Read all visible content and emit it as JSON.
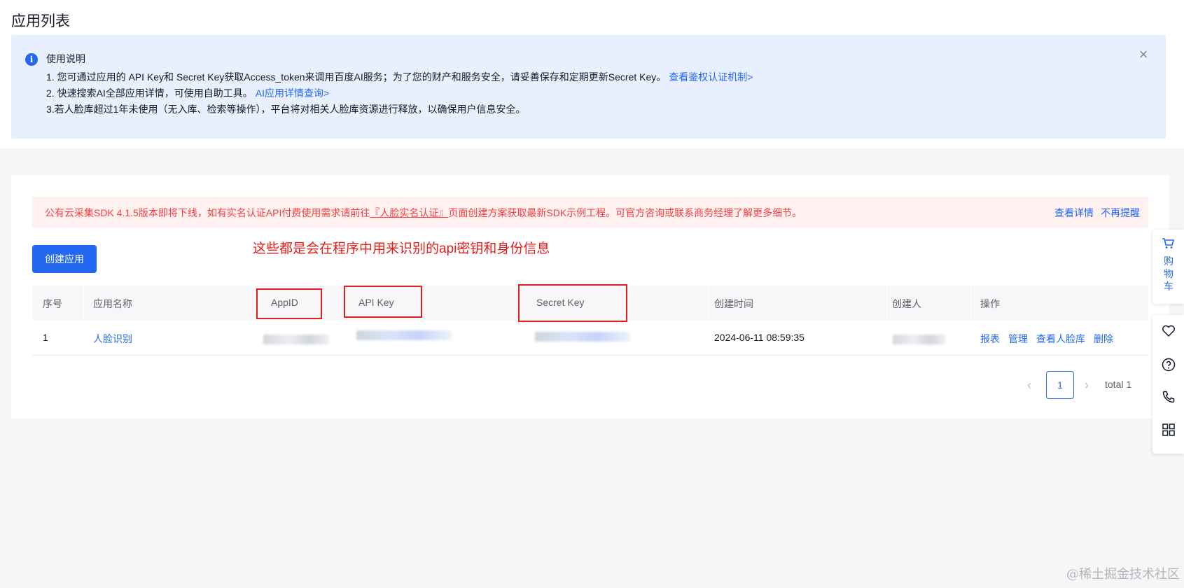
{
  "page_title": "应用列表",
  "notice": {
    "title": "使用说明",
    "line1_text": "1. 您可通过应用的 API Key和 Secret Key获取Access_token来调用百度AI服务；为了您的财产和服务安全，请妥善保存和定期更新Secret Key。",
    "line1_link": "查看鉴权认证机制>",
    "line2_text": "2. 快速搜索AI全部应用详情，可使用自助工具。",
    "line2_link": "AI应用详情查询>",
    "line3_text": "3.若人脸库超过1年未使用（无入库、检索等操作），平台将对相关人脸库资源进行释放，以确保用户信息安全。",
    "close": "×"
  },
  "warning": {
    "text_before": "公有云采集SDK 4.1.5版本即将下线，如有实名认证API付费使用需求请前往",
    "text_link": "『人脸实名认证』",
    "text_after": "页面创建方案获取最新SDK示例工程。可官方咨询或联系商务经理了解更多细节。",
    "action_details": "查看详情",
    "action_dismiss": "不再提醒"
  },
  "create_button": "创建应用",
  "annotation": "这些都是会在程序中用来识别的api密钥和身份信息",
  "table": {
    "headers": {
      "index": "序号",
      "name": "应用名称",
      "appid": "AppID",
      "apikey": "API Key",
      "secretkey": "Secret Key",
      "created": "创建时间",
      "creator": "创建人",
      "ops": "操作"
    },
    "rows": [
      {
        "index": "1",
        "name": "人脸识别",
        "created": "2024-06-11 08:59:35",
        "ops": [
          "报表",
          "管理",
          "查看人脸库",
          "删除"
        ]
      }
    ]
  },
  "pagination": {
    "prev": "‹",
    "current": "1",
    "next": "›",
    "total": "total 1"
  },
  "sidebar": {
    "cart_label": "购物车",
    "tools": [
      "heart-message-icon",
      "help-icon",
      "phone-icon",
      "grid-icon"
    ]
  },
  "watermark": "@稀土掘金技术社区",
  "colors": {
    "primary": "#2468f2",
    "annotation_red": "#e51c1c",
    "warning_red": "#f33e3e",
    "notice_bg": "#e8effe"
  }
}
